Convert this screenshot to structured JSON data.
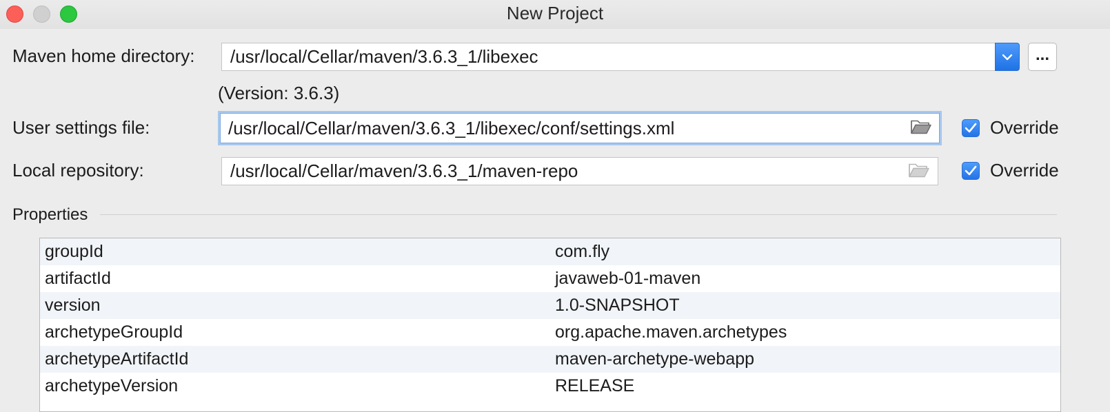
{
  "window": {
    "title": "New Project"
  },
  "maven_home": {
    "label": "Maven home directory:",
    "value": "/usr/local/Cellar/maven/3.6.3_1/libexec",
    "version_note": "(Version: 3.6.3)",
    "browse_label": "..."
  },
  "user_settings": {
    "label": "User settings file:",
    "value": "/usr/local/Cellar/maven/3.6.3_1/libexec/conf/settings.xml",
    "override_label": "Override",
    "override_checked": true
  },
  "local_repo": {
    "label": "Local repository:",
    "value": "/usr/local/Cellar/maven/3.6.3_1/maven-repo",
    "override_label": "Override",
    "override_checked": true
  },
  "properties": {
    "label": "Properties",
    "rows": [
      {
        "key": "groupId",
        "value": "com.fly"
      },
      {
        "key": "artifactId",
        "value": "javaweb-01-maven"
      },
      {
        "key": "version",
        "value": "1.0-SNAPSHOT"
      },
      {
        "key": "archetypeGroupId",
        "value": "org.apache.maven.archetypes"
      },
      {
        "key": "archetypeArtifactId",
        "value": "maven-archetype-webapp"
      },
      {
        "key": "archetypeVersion",
        "value": "RELEASE"
      }
    ]
  },
  "colors": {
    "accent": "#2473e8",
    "focus_ring": "#a6c8ef",
    "close": "#fc5f57",
    "zoom": "#2bc840"
  },
  "icons": [
    "chevron-down-icon",
    "folder-icon",
    "checkmark-icon"
  ]
}
